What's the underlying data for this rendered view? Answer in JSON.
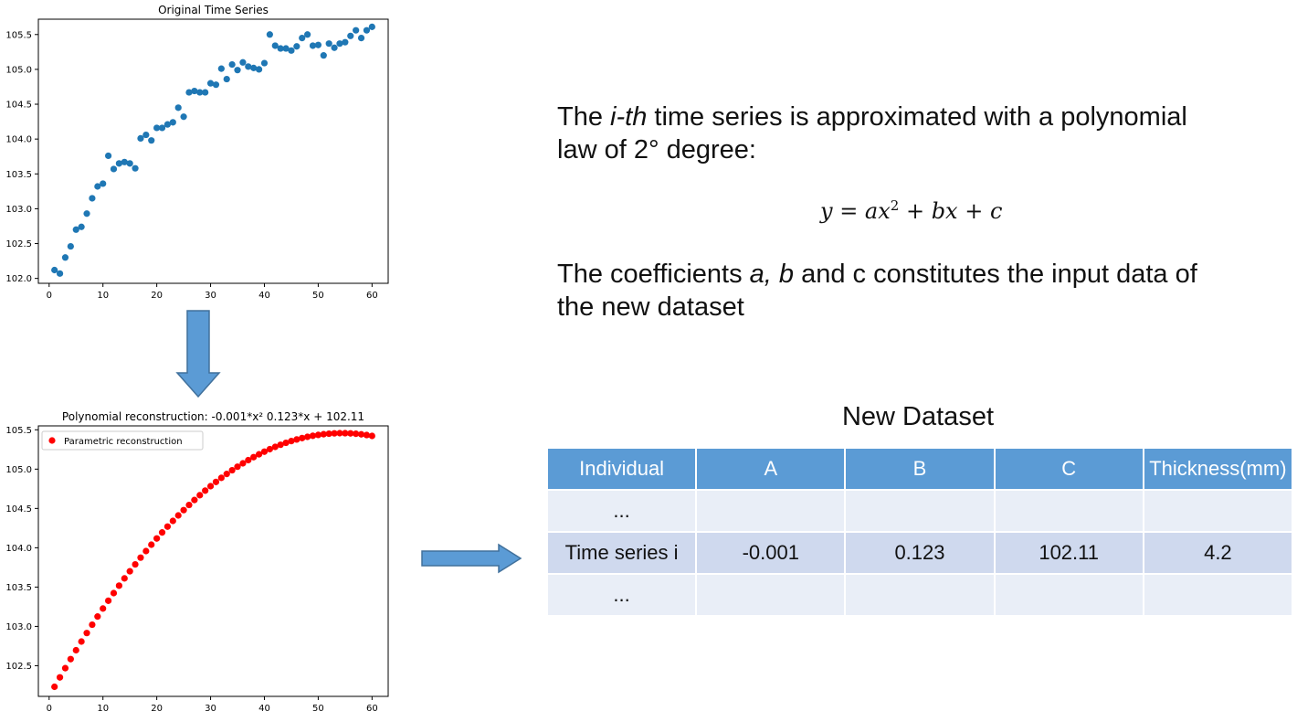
{
  "chart_data": [
    {
      "type": "scatter",
      "title": "Original Time Series",
      "xlabel": "",
      "ylabel": "",
      "xlim": [
        -2,
        63
      ],
      "ylim": [
        101.93,
        105.72
      ],
      "xticks": [
        0,
        10,
        20,
        30,
        40,
        50,
        60
      ],
      "yticks": [
        102.0,
        102.5,
        103.0,
        103.5,
        104.0,
        104.5,
        105.0,
        105.5
      ],
      "ytick_labels": [
        "102.0",
        "102.5",
        "103.0",
        "103.5",
        "104.0",
        "104.5",
        "105.0",
        "105.5"
      ],
      "grid": false,
      "marker_color": "#1f77b4",
      "x": [
        1,
        2,
        3,
        4,
        5,
        6,
        7,
        8,
        9,
        10,
        11,
        12,
        13,
        14,
        15,
        16,
        17,
        18,
        19,
        20,
        21,
        22,
        23,
        24,
        25,
        26,
        27,
        28,
        29,
        30,
        31,
        32,
        33,
        34,
        35,
        36,
        37,
        38,
        39,
        40,
        41,
        42,
        43,
        44,
        45,
        46,
        47,
        48,
        49,
        50,
        51,
        52,
        53,
        54,
        55,
        56,
        57,
        58,
        59,
        60
      ],
      "y": [
        102.12,
        102.07,
        102.3,
        102.46,
        102.7,
        102.74,
        102.93,
        103.15,
        103.32,
        103.36,
        103.76,
        103.57,
        103.65,
        103.67,
        103.65,
        103.58,
        104.01,
        104.06,
        103.98,
        104.16,
        104.16,
        104.21,
        104.24,
        104.45,
        104.32,
        104.67,
        104.69,
        104.67,
        104.67,
        104.8,
        104.78,
        105.01,
        104.86,
        105.07,
        104.99,
        105.1,
        105.04,
        105.02,
        105.0,
        105.09,
        105.5,
        105.34,
        105.3,
        105.3,
        105.27,
        105.33,
        105.45,
        105.5,
        105.34,
        105.35,
        105.2,
        105.37,
        105.31,
        105.37,
        105.39,
        105.48,
        105.56,
        105.45,
        105.56,
        105.61
      ]
    },
    {
      "type": "scatter",
      "title": "Polynomial reconstruction: -0.001*x² 0.123*x + 102.11",
      "xlabel": "",
      "ylabel": "",
      "xlim": [
        -2,
        63
      ],
      "ylim": [
        102.11,
        105.55
      ],
      "xticks": [
        0,
        10,
        20,
        30,
        40,
        50,
        60
      ],
      "yticks": [
        102.5,
        103.0,
        103.5,
        104.0,
        104.5,
        105.0,
        105.5
      ],
      "ytick_labels": [
        "102.5",
        "103.0",
        "103.5",
        "104.0",
        "104.5",
        "105.0",
        "105.5"
      ],
      "grid": false,
      "marker_color": "#ff0000",
      "legend": "top-left",
      "series": [
        {
          "name": "Parametric reconstruction",
          "coefficients": [
            -0.00113,
            0.123,
            102.11
          ]
        }
      ],
      "x": [
        1,
        2,
        3,
        4,
        5,
        6,
        7,
        8,
        9,
        10,
        11,
        12,
        13,
        14,
        15,
        16,
        17,
        18,
        19,
        20,
        21,
        22,
        23,
        24,
        25,
        26,
        27,
        28,
        29,
        30,
        31,
        32,
        33,
        34,
        35,
        36,
        37,
        38,
        39,
        40,
        41,
        42,
        43,
        44,
        45,
        46,
        47,
        48,
        49,
        50,
        51,
        52,
        53,
        54,
        55,
        56,
        57,
        58,
        59,
        60
      ]
    }
  ],
  "text": {
    "line1_a": "The ",
    "line1_em": "i-th",
    "line1_b": " time series is approximated with a polynomial",
    "line2": "law of 2° degree:",
    "coef_a": "The coefficients ",
    "coef_em": "a, b",
    "coef_b": " and c constitutes the input data of",
    "coef_line2": "the new dataset"
  },
  "formula": {
    "lhs": "y = ax",
    "exp": "2",
    "rhs": " + bx + c"
  },
  "table": {
    "title": "New Dataset",
    "headers": [
      "Individual",
      "A",
      "B",
      "C",
      "Thickness(mm)"
    ],
    "rows": [
      [
        "...",
        "",
        "",
        "",
        ""
      ],
      [
        "Time series i",
        "-0.001",
        "0.123",
        "102.11",
        "4.2"
      ],
      [
        "...",
        "",
        "",
        "",
        ""
      ]
    ]
  },
  "colors": {
    "header_bg": "#5b9bd5",
    "row_light": "#e9eef7",
    "row_dark": "#cfd9ee",
    "arrow": "#5b9bd5"
  }
}
